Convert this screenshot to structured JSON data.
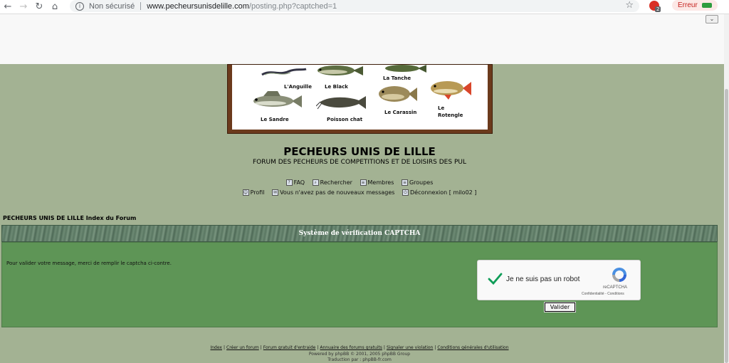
{
  "browser": {
    "security_label": "Non sécurisé",
    "url_host": "www.pecheursunisdelille.com",
    "url_path": "/posting.php?captched=1",
    "extension_badge": "2",
    "error_label": "Erreur"
  },
  "banner": {
    "fish": [
      {
        "label": "L'Anguille"
      },
      {
        "label": "Le Black"
      },
      {
        "label": "La Tanche"
      },
      {
        "label": "Le Sandre"
      },
      {
        "label": "Poisson chat"
      },
      {
        "label": "Le Carassin"
      },
      {
        "label": "Le"
      },
      {
        "label": "Rotengle"
      }
    ]
  },
  "site": {
    "title": "PECHEURS UNIS DE LILLE",
    "subtitle": "FORUM DES PECHEURS DE COMPETITIONS ET DE LOISIRS DES PUL"
  },
  "nav": {
    "row1": [
      "FAQ",
      "Rechercher",
      "Membres",
      "Groupes"
    ],
    "row2": [
      "Profil",
      "Vous n'avez pas de nouveaux messages",
      "Déconnexion [ milo02 ]"
    ]
  },
  "breadcrumb": "PECHEURS UNIS DE LILLE Index du Forum",
  "captcha": {
    "header": "Système de vérification CAPTCHA",
    "message": "Pour valider votre message, merci de remplir le captcha ci-contre.",
    "recaptcha_label": "Je ne suis pas un robot",
    "recaptcha_brand": "reCAPTCHA",
    "recaptcha_links": "Confidentialité - Conditions",
    "submit_label": "Valider"
  },
  "footer": {
    "links": [
      "Index",
      "Créer un forum",
      "Forum gratuit d'entraide",
      "Annuaire des forums gratuits",
      "Signaler une violation",
      "Conditions générales d'utilisation"
    ],
    "powered": "Powered by phpBB © 2001, 2005 phpBB Group",
    "translation": "Traduction par : phpBB-fr.com"
  },
  "colors": {
    "page_bg": "#a3b293",
    "panel_bg": "#5e9556",
    "check_green": "#0f9d58"
  }
}
